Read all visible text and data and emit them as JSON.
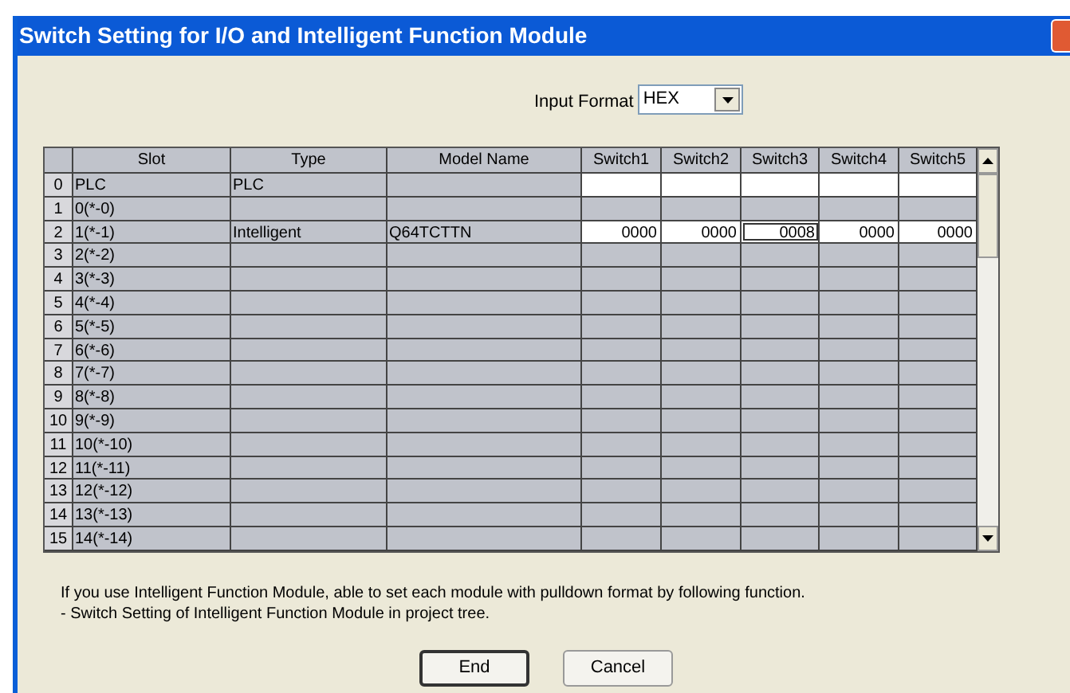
{
  "window": {
    "title": "Switch Setting for I/O and Intelligent Function Module"
  },
  "input_format": {
    "label": "Input Format",
    "value": "HEX"
  },
  "table": {
    "columns": [
      "Slot",
      "Type",
      "Model Name",
      "Switch1",
      "Switch2",
      "Switch3",
      "Switch4",
      "Switch5"
    ],
    "rows": [
      {
        "number": "0",
        "slot": "PLC",
        "type": "PLC",
        "editable": true
      },
      {
        "number": "1",
        "slot": "0(*-0)",
        "editable": false
      },
      {
        "number": "2",
        "slot": "1(*-1)",
        "type": "Intelligent",
        "model": "Q64TCTTN",
        "editable": true,
        "switches": [
          {
            "value": "0000",
            "selected": false
          },
          {
            "value": "0000",
            "selected": false
          },
          {
            "value": "0008",
            "selected": true
          },
          {
            "value": "0000",
            "selected": false
          },
          {
            "value": "0000",
            "selected": false
          }
        ]
      },
      {
        "number": "3",
        "slot": "2(*-2)",
        "editable": false
      },
      {
        "number": "4",
        "slot": "3(*-3)",
        "editable": false
      },
      {
        "number": "5",
        "slot": "4(*-4)",
        "editable": false
      },
      {
        "number": "6",
        "slot": "5(*-5)",
        "editable": false
      },
      {
        "number": "7",
        "slot": "6(*-6)",
        "editable": false
      },
      {
        "number": "8",
        "slot": "7(*-7)",
        "editable": false
      },
      {
        "number": "9",
        "slot": "8(*-8)",
        "editable": false
      },
      {
        "number": "10",
        "slot": "9(*-9)",
        "editable": false
      },
      {
        "number": "11",
        "slot": "10(*-10)",
        "editable": false
      },
      {
        "number": "12",
        "slot": "11(*-11)",
        "editable": false
      },
      {
        "number": "13",
        "slot": "12(*-12)",
        "editable": false
      },
      {
        "number": "14",
        "slot": "13(*-13)",
        "editable": false
      },
      {
        "number": "15",
        "slot": "14(*-14)",
        "editable": false
      }
    ]
  },
  "notes": [
    "If you use Intelligent Function Module, able to set each module with pulldown format by following function.",
    "- Switch Setting of Intelligent Function Module in project tree."
  ],
  "buttons": [
    {
      "label": "End",
      "default": true
    },
    {
      "label": "Cancel",
      "default": false
    }
  ]
}
